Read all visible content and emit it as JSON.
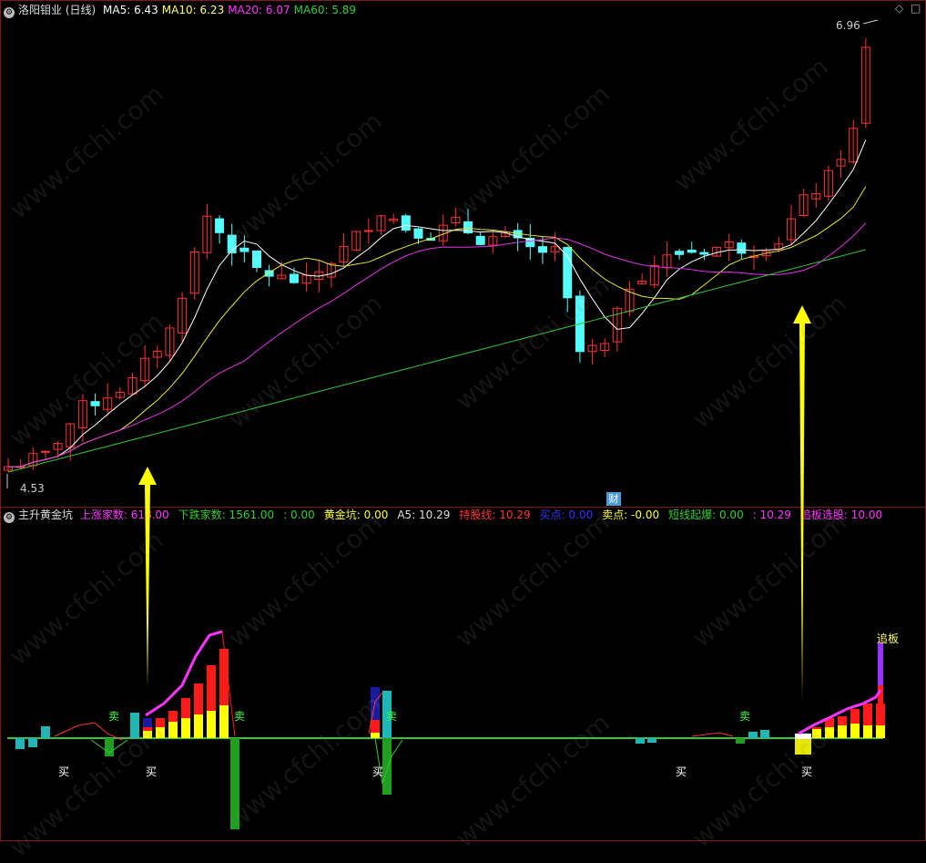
{
  "stock": {
    "title": "洛阳钼业 (日线)"
  },
  "main_header": [
    {
      "label": "MA5: 6.43",
      "color": "#ffffff"
    },
    {
      "label": "MA10: 6.23",
      "color": "#ffff66"
    },
    {
      "label": "MA20: 6.07",
      "color": "#ff33ff"
    },
    {
      "label": "MA60: 5.89",
      "color": "#33cc33"
    }
  ],
  "indicator": {
    "name": "主升黄金坑",
    "params": [
      {
        "label": "上涨家数: 618.00",
        "color": "#ff33ff"
      },
      {
        "label": "下跌家数: 1561.00",
        "color": "#33cc33"
      },
      {
        "label": ": 0.00",
        "color": "#33cc33"
      },
      {
        "label": "黄金坑: 0.00",
        "color": "#ffff33"
      },
      {
        "label": "A5: 10.29",
        "color": "#dddddd"
      },
      {
        "label": "持股线: 10.29",
        "color": "#ff3333"
      },
      {
        "label": "买点: 0.00",
        "color": "#3333ff"
      },
      {
        "label": "卖点: -0.00",
        "color": "#ffff33"
      },
      {
        "label": "短线起爆: 0.00",
        "color": "#33cc33"
      },
      {
        "label": ": 10.29",
        "color": "#ff33ff"
      },
      {
        "label": "追板选股: 10.00",
        "color": "#ff33ff"
      }
    ]
  },
  "price_labels": {
    "high": "6.96",
    "low": "4.53"
  },
  "markers": {
    "cai": "财",
    "buy": "买",
    "sell": "卖",
    "chase": "追板"
  },
  "watermark": "www.cfchi.com",
  "colors": {
    "up": "#ff3232",
    "down": "#54fcfc",
    "ma5": "#ffffff",
    "ma10": "#e6e632",
    "ma20": "#e632e6",
    "ma60": "#32c832",
    "arrow": "#ffff00"
  }
}
